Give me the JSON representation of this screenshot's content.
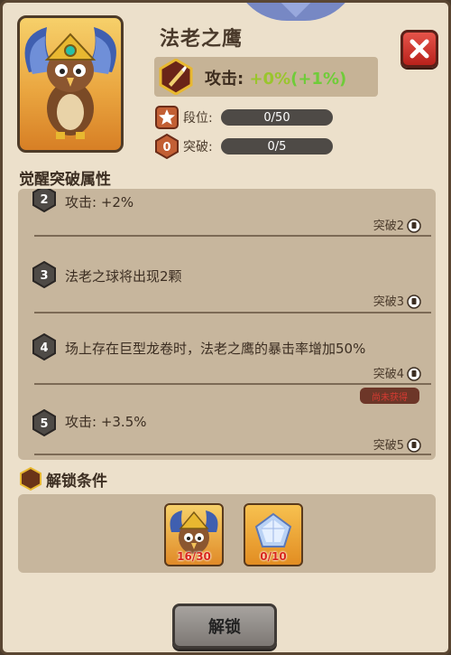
{
  "hero": {
    "name": "法老之鹰",
    "attack_label": "攻击: ",
    "attack_value": "+0%",
    "attack_bonus": "(+1%)"
  },
  "stats": [
    {
      "label": "段位:",
      "value": "0/50"
    },
    {
      "label": "突破:",
      "value": "0/5",
      "badge": "0"
    }
  ],
  "section_title": "觉醒突破属性",
  "attributes": [
    {
      "level": "2",
      "desc": "攻击: +2%",
      "requirement": "突破2"
    },
    {
      "level": "3",
      "desc": "法老之球将出现2颗",
      "requirement": "突破3"
    },
    {
      "level": "4",
      "desc": "场上存在巨型龙卷时，法老之鹰的暴击率增加50%",
      "requirement": "突破4",
      "tag": "尚未获得"
    },
    {
      "level": "5",
      "desc": "攻击: +3.5%",
      "requirement": "突破5"
    }
  ],
  "unlock": {
    "title": "解锁条件",
    "items": [
      {
        "icon": "pharaoh-eagle-icon",
        "count": "16/30"
      },
      {
        "icon": "crystal-gem-icon",
        "count": "0/10"
      }
    ],
    "button": "解锁"
  },
  "colors": {
    "panel": "#ece0cb",
    "box": "#c7b69d",
    "accent_green": "#6fcc39",
    "close_red": "#c62a22"
  }
}
